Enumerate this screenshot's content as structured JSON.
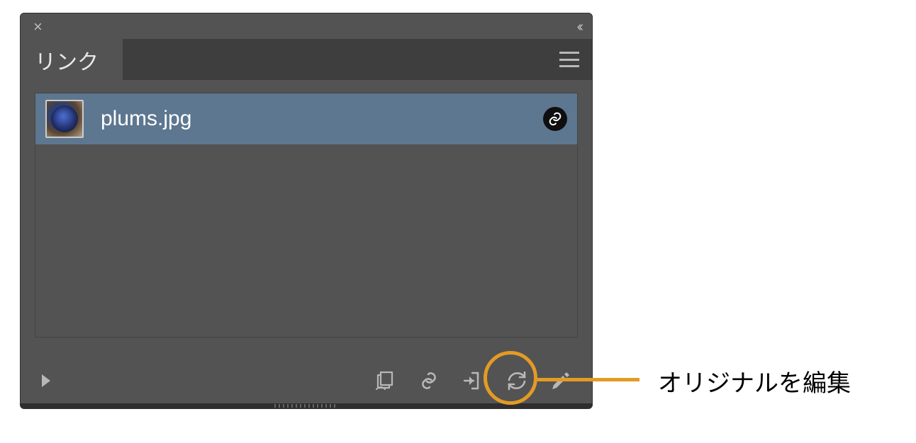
{
  "panel": {
    "tab_label": "リンク"
  },
  "link_item": {
    "filename": "plums.jpg"
  },
  "callout": {
    "label": "オリジナルを編集"
  }
}
